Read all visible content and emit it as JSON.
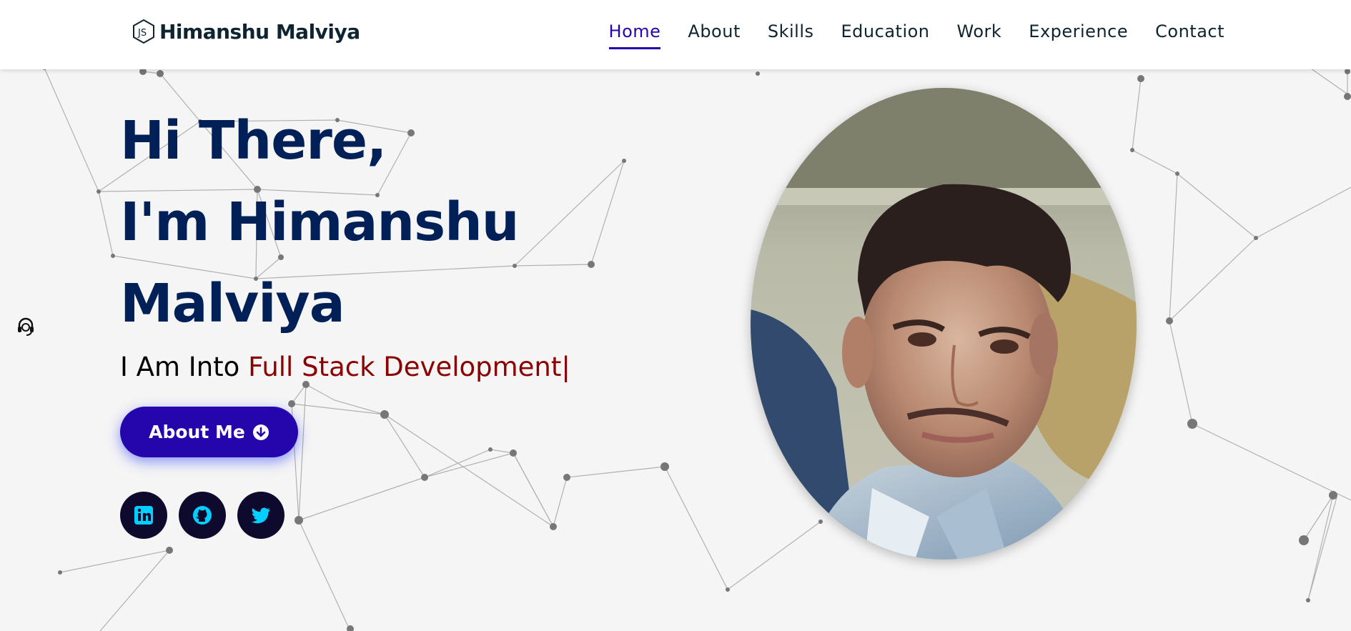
{
  "header": {
    "logo_text": "Himanshu Malviya",
    "logo_icon": "nodejs-icon",
    "nav": [
      {
        "label": "Home",
        "active": true
      },
      {
        "label": "About"
      },
      {
        "label": "Skills"
      },
      {
        "label": "Education"
      },
      {
        "label": "Work"
      },
      {
        "label": "Experience"
      },
      {
        "label": "Contact"
      }
    ]
  },
  "hero": {
    "line1": "Hi There,",
    "line2": "I'm Himanshu",
    "line3": "Malviya",
    "typed_prefix": "I Am Into ",
    "typed_role": "Full Stack Development|",
    "button_label": "About Me",
    "socials": [
      {
        "name": "linkedin-icon"
      },
      {
        "name": "github-icon"
      },
      {
        "name": "twitter-icon"
      }
    ]
  },
  "colors": {
    "accent": "#2506ad",
    "heading": "#002057",
    "role": "#8b0000",
    "social_bg": "#0e0a2e",
    "social_icon": "#00d0ff"
  }
}
